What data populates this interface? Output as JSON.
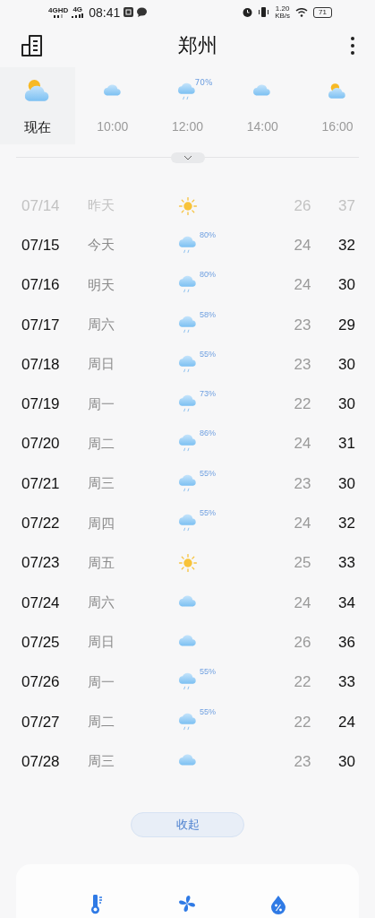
{
  "status_bar": {
    "network_1": "4GHD",
    "network_2": "4G",
    "time": "08:41",
    "speed": "1.20",
    "speed_unit": "KB/s",
    "battery": "71"
  },
  "header": {
    "title": "郑州"
  },
  "hourly": [
    {
      "label": "现在",
      "kind": "partly",
      "selected": true
    },
    {
      "label": "10:00",
      "kind": "cloud",
      "selected": false
    },
    {
      "label": "12:00",
      "kind": "rain",
      "precip": "70%",
      "selected": false
    },
    {
      "label": "14:00",
      "kind": "cloud",
      "selected": false
    },
    {
      "label": "16:00",
      "kind": "partly",
      "selected": false
    }
  ],
  "daily": [
    {
      "date": "07/14",
      "day": "昨天",
      "kind": "sun",
      "low": "26",
      "high": "37",
      "past": true
    },
    {
      "date": "07/15",
      "day": "今天",
      "kind": "rain",
      "precip": "80%",
      "low": "24",
      "high": "32",
      "past": false
    },
    {
      "date": "07/16",
      "day": "明天",
      "kind": "rain",
      "precip": "80%",
      "low": "24",
      "high": "30",
      "past": false
    },
    {
      "date": "07/17",
      "day": "周六",
      "kind": "rain",
      "precip": "58%",
      "low": "23",
      "high": "29",
      "past": false
    },
    {
      "date": "07/18",
      "day": "周日",
      "kind": "rain",
      "precip": "55%",
      "low": "23",
      "high": "30",
      "past": false
    },
    {
      "date": "07/19",
      "day": "周一",
      "kind": "rain",
      "precip": "73%",
      "low": "22",
      "high": "30",
      "past": false
    },
    {
      "date": "07/20",
      "day": "周二",
      "kind": "rain",
      "precip": "86%",
      "low": "24",
      "high": "31",
      "past": false
    },
    {
      "date": "07/21",
      "day": "周三",
      "kind": "rain",
      "precip": "55%",
      "low": "23",
      "high": "30",
      "past": false
    },
    {
      "date": "07/22",
      "day": "周四",
      "kind": "rain",
      "precip": "55%",
      "low": "24",
      "high": "32",
      "past": false
    },
    {
      "date": "07/23",
      "day": "周五",
      "kind": "sun",
      "low": "25",
      "high": "33",
      "past": false
    },
    {
      "date": "07/24",
      "day": "周六",
      "kind": "cloud",
      "low": "24",
      "high": "34",
      "past": false
    },
    {
      "date": "07/25",
      "day": "周日",
      "kind": "cloud",
      "low": "26",
      "high": "36",
      "past": false
    },
    {
      "date": "07/26",
      "day": "周一",
      "kind": "rain",
      "precip": "55%",
      "low": "22",
      "high": "33",
      "past": false
    },
    {
      "date": "07/27",
      "day": "周二",
      "kind": "rain",
      "precip": "55%",
      "low": "22",
      "high": "24",
      "past": false
    },
    {
      "date": "07/28",
      "day": "周三",
      "kind": "cloud",
      "low": "23",
      "high": "30",
      "past": false
    }
  ],
  "collapse_button": "收起",
  "details": [
    {
      "kind": "thermometer"
    },
    {
      "kind": "fan"
    },
    {
      "kind": "humidity"
    }
  ]
}
